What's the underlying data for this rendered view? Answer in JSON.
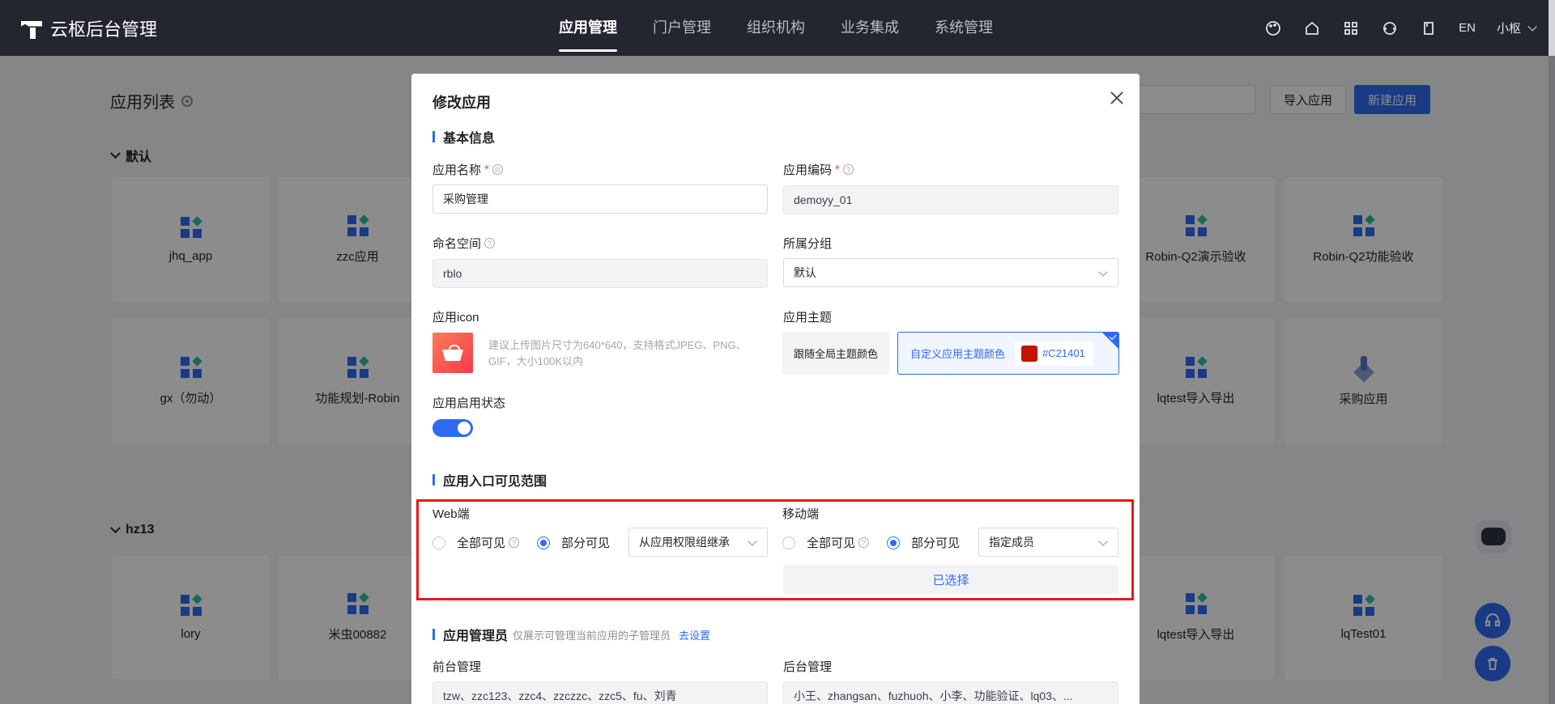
{
  "nav": {
    "brand": "云枢后台管理",
    "menu": [
      "应用管理",
      "门户管理",
      "组织机构",
      "业务集成",
      "系统管理"
    ],
    "lang": "EN",
    "user": "小枢"
  },
  "page": {
    "title": "应用列表",
    "import_btn": "导入应用",
    "new_btn": "新建应用",
    "group1": "默认",
    "group2": "hz13",
    "row1_left": [
      "jhq_app",
      "zzc应用"
    ],
    "row1_right": [
      "Robin-Q2演示验收",
      "Robin-Q2功能验收"
    ],
    "row2_left": [
      "gx（勿动）",
      "功能规划-Robin"
    ],
    "row2_right": [
      "lqtest导入导出",
      "采购应用"
    ],
    "row3_left": [
      "lory",
      "米虫00882"
    ],
    "row3_right": [
      "lqtest导入导出",
      "lqTest01"
    ]
  },
  "modal": {
    "title": "修改应用",
    "section_basic": "基本信息",
    "app_name_label": "应用名称",
    "app_name_value": "采购管理",
    "app_code_label": "应用编码",
    "app_code_value": "demoyy_01",
    "namespace_label": "命名空间",
    "namespace_value": "rblo",
    "group_label": "所属分组",
    "group_value": "默认",
    "icon_label": "应用icon",
    "icon_hint": "建议上传图片尺寸为640*640，支持格式JPEG、PNG、GIF，大小100K以内",
    "theme_label": "应用主题",
    "theme_follow": "跟随全局主题颜色",
    "theme_custom": "自定义应用主题颜色",
    "theme_color": "#C21401",
    "status_label": "应用启用状态",
    "status_on": true,
    "section_visible": "应用入口可见范围",
    "web_label": "Web端",
    "mobile_label": "移动端",
    "all_visible": "全部可见",
    "part_visible": "部分可见",
    "web_select": "从应用权限组继承",
    "mobile_select": "指定成员",
    "chosen_btn": "已选择",
    "section_admin": "应用管理员",
    "admin_sub": "仅展示可管理当前应用的子管理员",
    "admin_link": "去设置",
    "front_label": "前台管理",
    "front_value": "tzw、zzc123、zzc4、zzczzc、zzc5、fu、刘青",
    "back_label": "后台管理",
    "back_value": "小王、zhangsan、fuzhuoh、小李、功能验证、lq03、..."
  }
}
